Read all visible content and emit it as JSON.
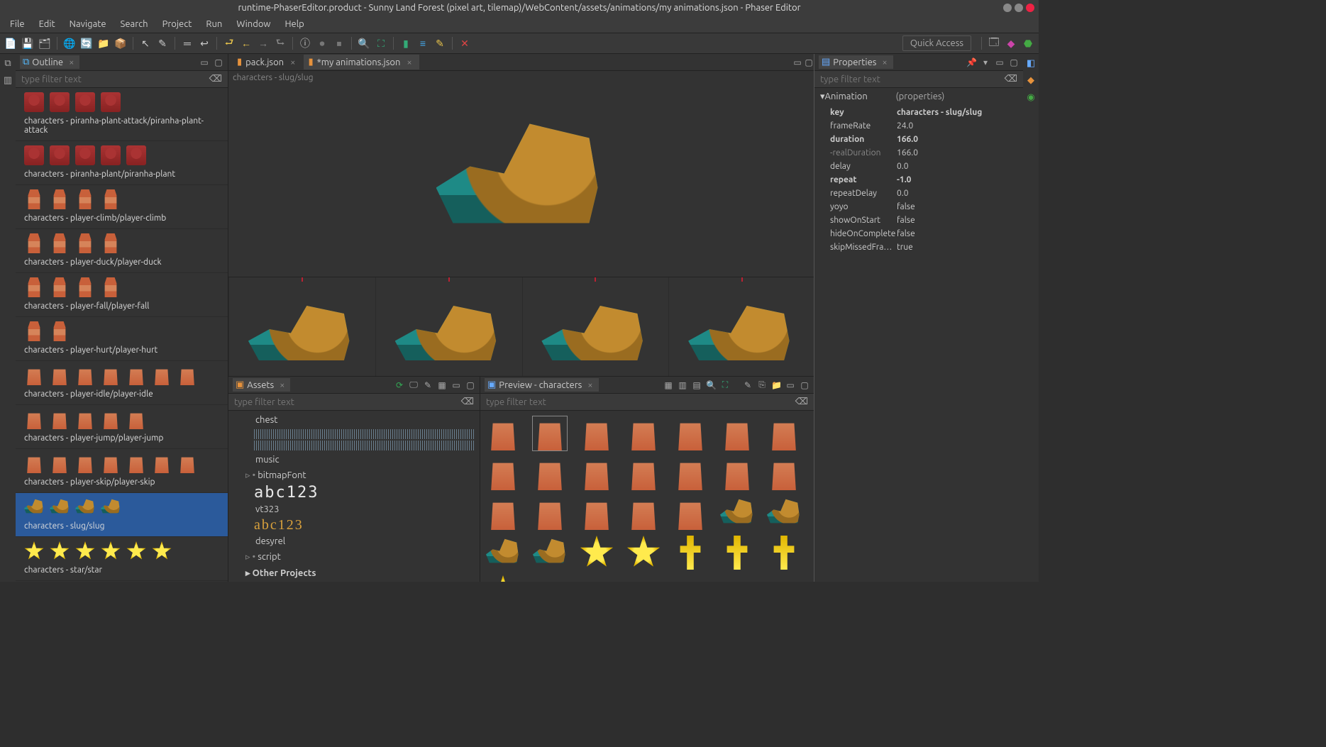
{
  "window": {
    "title": "runtime-PhaserEditor.product - Sunny Land Forest (pixel art, tilemap)/WebContent/assets/animations/my animations.json - Phaser Editor"
  },
  "menu": [
    "File",
    "Edit",
    "Navigate",
    "Search",
    "Project",
    "Run",
    "Window",
    "Help"
  ],
  "quickAccess": "Quick Access",
  "tabs": {
    "editor": [
      {
        "label": "pack.json",
        "dirty": false,
        "active": false
      },
      {
        "label": "my animations.json",
        "dirty": true,
        "active": true
      }
    ],
    "outline": "Outline",
    "assets": "Assets",
    "preview": "Preview - characters",
    "properties": "Properties"
  },
  "filters": {
    "placeholder": "type filter text"
  },
  "animationPath": "characters - slug/slug",
  "outline": [
    {
      "label": "characters - piranha-plant-attack/piranha-plant-attack",
      "sprite": "red",
      "count": 4
    },
    {
      "label": "characters - piranha-plant/piranha-plant",
      "sprite": "red",
      "count": 5
    },
    {
      "label": "characters - player-climb/player-climb",
      "sprite": "pl",
      "count": 4
    },
    {
      "label": "characters - player-duck/player-duck",
      "sprite": "pl",
      "count": 4
    },
    {
      "label": "characters - player-fall/player-fall",
      "sprite": "pl",
      "count": 4
    },
    {
      "label": "characters - player-hurt/player-hurt",
      "sprite": "pl",
      "count": 2
    },
    {
      "label": "characters - player-idle/player-idle",
      "sprite": "plr",
      "count": 7
    },
    {
      "label": "characters - player-jump/player-jump",
      "sprite": "plr",
      "count": 5
    },
    {
      "label": "characters - player-skip/player-skip",
      "sprite": "plr",
      "count": 7
    },
    {
      "label": "characters - slug/slug",
      "sprite": "slug",
      "count": 4,
      "selected": true
    },
    {
      "label": "characters - star/star",
      "sprite": "star",
      "count": 6
    }
  ],
  "assets": {
    "items": [
      {
        "type": "label",
        "text": "chest",
        "indent": 2
      },
      {
        "type": "wave"
      },
      {
        "type": "wave"
      },
      {
        "type": "label",
        "text": "music",
        "indent": 2
      },
      {
        "type": "node",
        "text": "bitmapFont",
        "indent": 1
      },
      {
        "type": "bmf",
        "text": "abc123",
        "cls": ""
      },
      {
        "type": "label",
        "text": "vt323",
        "indent": 2
      },
      {
        "type": "bmf",
        "text": "abc123",
        "cls": "cursive"
      },
      {
        "type": "label",
        "text": "desyrel",
        "indent": 2
      },
      {
        "type": "node",
        "text": "script",
        "indent": 1
      },
      {
        "type": "bold",
        "text": "Other Projects"
      }
    ]
  },
  "preview": {
    "cells": [
      {
        "s": "plr"
      },
      {
        "s": "plr",
        "sel": true
      },
      {
        "s": "plr"
      },
      {
        "s": "plr"
      },
      {
        "s": "plr"
      },
      {
        "s": "plr"
      },
      {
        "s": "plr"
      },
      {
        "s": "plr"
      },
      {
        "s": "plr"
      },
      {
        "s": "plr"
      },
      {
        "s": "plr"
      },
      {
        "s": "plr"
      },
      {
        "s": "plr"
      },
      {
        "s": "plr"
      },
      {
        "s": "plr"
      },
      {
        "s": "plr"
      },
      {
        "s": "plr"
      },
      {
        "s": "plr"
      },
      {
        "s": "plr"
      },
      {
        "s": "slug"
      },
      {
        "s": "slug"
      },
      {
        "s": "slug"
      },
      {
        "s": "slug"
      },
      {
        "s": "star"
      },
      {
        "s": "star"
      },
      {
        "s": "hum"
      },
      {
        "s": "hum"
      },
      {
        "s": "hum"
      },
      {
        "s": "star"
      }
    ]
  },
  "properties": {
    "header": {
      "label": "Animation",
      "meta": "(properties)"
    },
    "rows": [
      {
        "k": "key",
        "v": "characters - slug/slug",
        "bold": true
      },
      {
        "k": "frameRate",
        "v": "24.0"
      },
      {
        "k": "duration",
        "v": "166.0",
        "bold": true
      },
      {
        "k": "-realDuration",
        "v": "166.0",
        "dim": true
      },
      {
        "k": "delay",
        "v": "0.0"
      },
      {
        "k": "repeat",
        "v": "-1.0",
        "bold": true
      },
      {
        "k": "repeatDelay",
        "v": "0.0"
      },
      {
        "k": "yoyo",
        "v": "false"
      },
      {
        "k": "showOnStart",
        "v": "false"
      },
      {
        "k": "hideOnComplete",
        "v": "false"
      },
      {
        "k": "skipMissedFrames",
        "v": "true"
      }
    ]
  }
}
